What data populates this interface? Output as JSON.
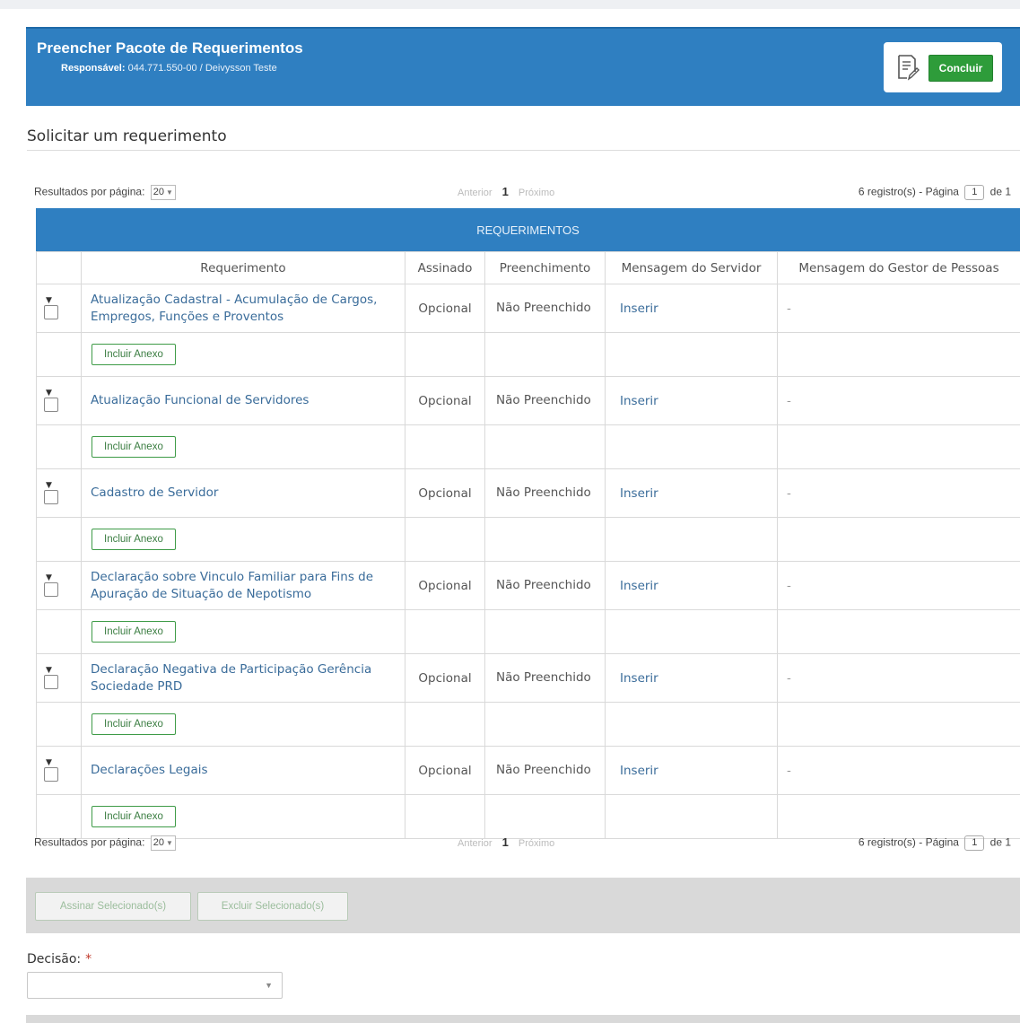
{
  "header": {
    "title": "Preencher Pacote de Requerimentos",
    "responsavel_label": "Responsável:",
    "responsavel_value": "044.771.550-00 / Deivysson Teste",
    "concluir_label": "Concluir",
    "header_color": "#2f7fc1"
  },
  "section": {
    "title": "Solicitar um requerimento"
  },
  "pager": {
    "rpp_label": "Resultados por página:",
    "rpp_value": "20",
    "prev_label": "Anterior",
    "current_page": "1",
    "next_label": "Próximo",
    "records_label": "6 registro(s) - Página",
    "page_input": "1",
    "of_label": "de 1"
  },
  "grid": {
    "banner": "REQUERIMENTOS",
    "columns": [
      "Requerimento",
      "Assinado",
      "Preenchimento",
      "Mensagem do Servidor",
      "Mensagem do Gestor de Pessoas"
    ],
    "anexo_label": "Incluir Anexo",
    "rows": [
      {
        "requerimento": "Atualização Cadastral - Acumulação de Cargos, Empregos, Funções e Proventos",
        "assinado": "Opcional",
        "preenchimento": "Não Preenchido",
        "msg_servidor": "Inserir",
        "msg_gestor": "-"
      },
      {
        "requerimento": "Atualização Funcional de Servidores",
        "assinado": "Opcional",
        "preenchimento": "Não Preenchido",
        "msg_servidor": "Inserir",
        "msg_gestor": "-"
      },
      {
        "requerimento": "Cadastro de Servidor",
        "assinado": "Opcional",
        "preenchimento": "Não Preenchido",
        "msg_servidor": "Inserir",
        "msg_gestor": "-"
      },
      {
        "requerimento": "Declaração sobre Vinculo Familiar para Fins de Apuração de Situação de Nepotismo",
        "assinado": "Opcional",
        "preenchimento": "Não Preenchido",
        "msg_servidor": "Inserir",
        "msg_gestor": "-"
      },
      {
        "requerimento": "Declaração Negativa de Participação Gerência Sociedade PRD",
        "assinado": "Opcional",
        "preenchimento": "Não Preenchido",
        "msg_servidor": "Inserir",
        "msg_gestor": "-"
      },
      {
        "requerimento": "Declarações Legais",
        "assinado": "Opcional",
        "preenchimento": "Não Preenchido",
        "msg_servidor": "Inserir",
        "msg_gestor": "-"
      }
    ]
  },
  "actions": {
    "assinar_label": "Assinar Selecionado(s)",
    "excluir_label": "Excluir Selecionado(s)"
  },
  "decision": {
    "label": "Decisão:",
    "required_mark": "*",
    "value": ""
  }
}
